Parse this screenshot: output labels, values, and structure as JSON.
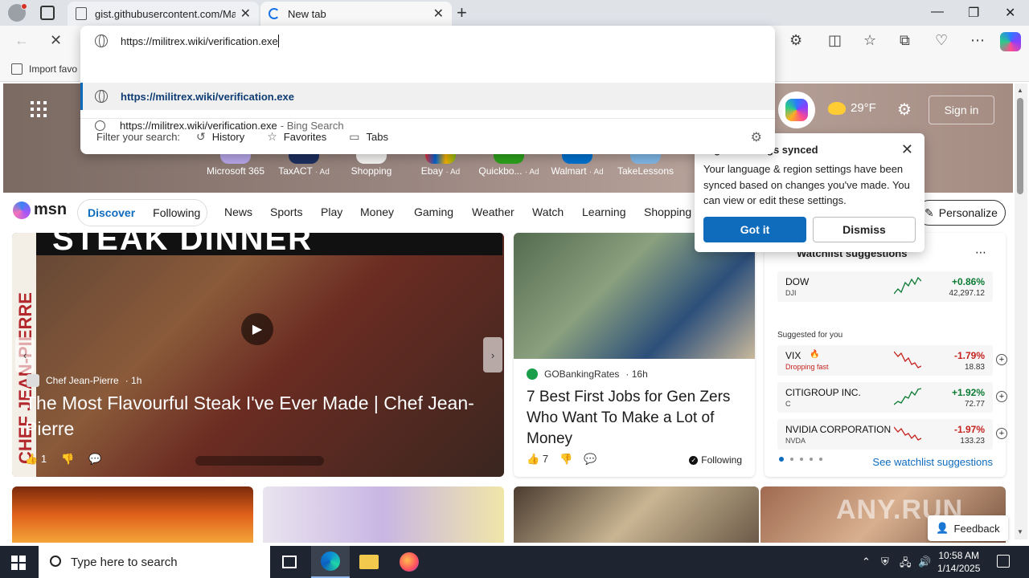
{
  "browser": {
    "tabs": [
      {
        "title": "gist.githubusercontent.com/Mar"
      },
      {
        "title": "New tab"
      }
    ],
    "omnibox": {
      "value": "https://militrex.wiki/verification.exe",
      "suggestions": [
        {
          "text": "https://militrex.wiki/verification.exe",
          "sub": ""
        },
        {
          "text": "https://militrex.wiki/verification.exe",
          "sub": "- Bing Search"
        }
      ],
      "filter_label": "Filter your search:",
      "filters": [
        "History",
        "Favorites",
        "Tabs"
      ]
    },
    "favorites_bar": {
      "import_label": "Import favo"
    }
  },
  "msn": {
    "weather": "29°F",
    "sign_in": "Sign in",
    "shortcuts": [
      {
        "label": "Microsoft 365",
        "ad": ""
      },
      {
        "label": "TaxACT",
        "ad": "· Ad"
      },
      {
        "label": "Shopping",
        "ad": ""
      },
      {
        "label": "Ebay",
        "ad": "· Ad"
      },
      {
        "label": "Quickbo...",
        "ad": "· Ad"
      },
      {
        "label": "Walmart",
        "ad": "· Ad"
      },
      {
        "label": "TakeLessons",
        "ad": ""
      }
    ],
    "logo": "msn",
    "feed_tabs": [
      "Discover",
      "Following"
    ],
    "nav": [
      "News",
      "Sports",
      "Play",
      "Money",
      "Gaming",
      "Weather",
      "Watch",
      "Learning",
      "Shopping"
    ],
    "personalize": "Personalize",
    "hero": {
      "banner": "STEAK DINNER",
      "vertical": "CHEF JEAN-PIERRE",
      "source": "Chef Jean-Pierre",
      "age": "· 1h",
      "headline": "The Most Flavourful Steak I've Ever Made | Chef Jean-Pierre",
      "likes": "1"
    },
    "card2": {
      "source": "GOBankingRates",
      "age": "· 16h",
      "headline": "7 Best First Jobs for Gen Zers Who Want To Make a Lot of Money",
      "likes": "7",
      "follow": "Following"
    },
    "watchlist": {
      "title": "Watchlist suggestions",
      "suggested_label": "Suggested for you",
      "link": "See watchlist suggestions",
      "items": [
        {
          "name": "DOW",
          "sub": "DJI",
          "pct": "+0.86%",
          "value": "42,297.12",
          "dir": "up"
        },
        {
          "name": "VIX",
          "sub": "Dropping fast",
          "pct": "-1.79%",
          "value": "18.83",
          "dir": "dn"
        },
        {
          "name": "CITIGROUP INC.",
          "sub": "C",
          "pct": "+1.92%",
          "value": "72.77",
          "dir": "up"
        },
        {
          "name": "NVIDIA CORPORATION",
          "sub": "NVDA",
          "pct": "-1.97%",
          "value": "133.23",
          "dir": "dn"
        }
      ]
    },
    "feedback": "Feedback",
    "watermark": "ANY.RUN"
  },
  "popup": {
    "title": "region settings synced",
    "body": "Your language & region settings have been synced based on changes you've made. You can view or edit these settings.",
    "got_it": "Got it",
    "dismiss": "Dismiss"
  },
  "taskbar": {
    "search_placeholder": "Type here to search",
    "time": "10:58 AM",
    "date": "1/14/2025"
  },
  "colors": {
    "accent": "#0f6cbd",
    "taskbar": "#1f2530",
    "up": "#0b7a32",
    "down": "#c5221f"
  }
}
